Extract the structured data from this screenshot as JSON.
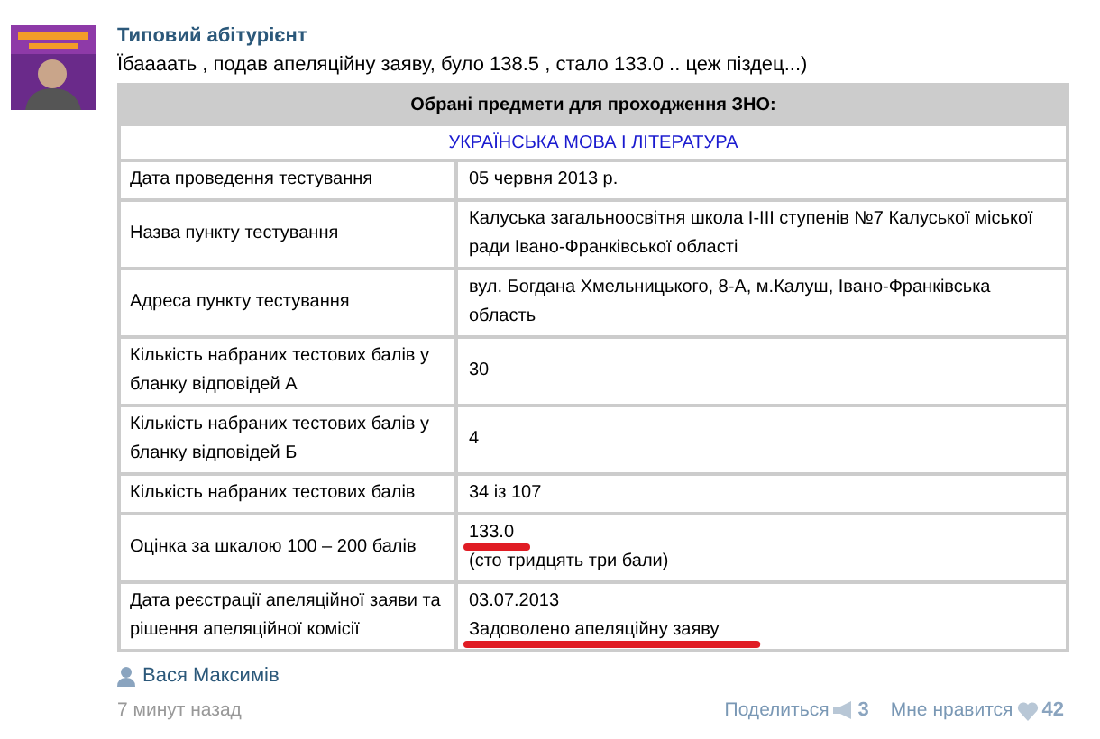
{
  "post": {
    "author": "Типовий абітурієнт",
    "text": "Їбаааать , подав апеляційну заяву, було 138.5 , стало 133.0 .. цеж піздец...)"
  },
  "table": {
    "header": "Обрані предмети для проходження ЗНО:",
    "subject": "УКРАЇНСЬКА МОВА І ЛІТЕРАТУРА",
    "rows": [
      {
        "label": "Дата проведення тестування",
        "values": [
          {
            "text": "05 червня 2013 р.",
            "underlined": false
          }
        ]
      },
      {
        "label": "Назва пункту тестування",
        "values": [
          {
            "text": "Калуська загальноосвітня школа І-ІІІ ступенів №7 Калуської міської ради Івано-Франківської області",
            "underlined": false
          }
        ]
      },
      {
        "label": "Адреса пункту тестування",
        "values": [
          {
            "text": "вул. Богдана Хмельницького, 8-А, м.Калуш, Івано-Франківська область",
            "underlined": false
          }
        ]
      },
      {
        "label": "Кількість набраних тестових балів у бланку відповідей А",
        "values": [
          {
            "text": "30",
            "underlined": false
          }
        ]
      },
      {
        "label": "Кількість набраних тестових балів у бланку відповідей Б",
        "values": [
          {
            "text": "4",
            "underlined": false
          }
        ]
      },
      {
        "label": "Кількість набраних тестових балів",
        "values": [
          {
            "text": "34 із 107",
            "underlined": false
          }
        ]
      },
      {
        "label": "Оцінка за шкалою 100 – 200 балів",
        "values": [
          {
            "text": "133.0",
            "underlined": true
          },
          {
            "text": "(сто тридцять три бали)",
            "underlined": false
          }
        ]
      },
      {
        "label": "Дата реєстрації апеляційної заяви та рішення апеляційної комісії",
        "values": [
          {
            "text": "03.07.2013",
            "underlined": false
          },
          {
            "text": "Задоволено апеляційну заяву",
            "underlined": true
          }
        ]
      }
    ]
  },
  "footer": {
    "signer": "Вася Максимів",
    "time": "7 минут назад",
    "share": "Поделиться",
    "share_count": "3",
    "like": "Мне нравится",
    "like_count": "42"
  }
}
